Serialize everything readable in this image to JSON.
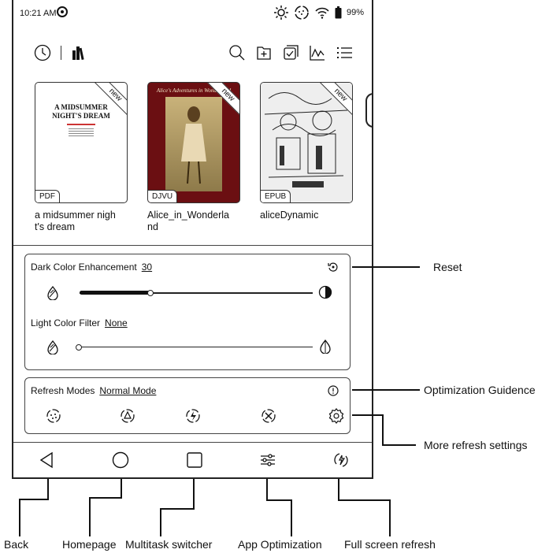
{
  "status_bar": {
    "time": "10:21 AM",
    "battery": "99%"
  },
  "toolbar": {
    "left_icons": [
      "clock-icon",
      "bookshelf-icon"
    ],
    "right_icons": [
      "search-icon",
      "import-icon",
      "select-icon",
      "stats-icon",
      "menu-icon"
    ]
  },
  "books": [
    {
      "title": "a midsummer night's dream",
      "format": "PDF",
      "badge": "new",
      "cover_text": "A MIDSUMMER NIGHT'S DREAM"
    },
    {
      "title": "Alice_in_Wonderland",
      "format": "DJVU",
      "badge": "new",
      "cover_text": "Alice's Adventures in Wonderland"
    },
    {
      "title": "aliceDynamic",
      "format": "EPUB",
      "badge": "new"
    }
  ],
  "panel": {
    "dark_label": "Dark Color Enhancement",
    "dark_value": "30",
    "dark_level": 0.3,
    "light_label": "Light Color Filter",
    "light_value": "None",
    "light_level": 0,
    "refresh_label": "Refresh Modes",
    "refresh_value": "Normal Mode"
  },
  "nav": [
    "back-icon",
    "home-icon",
    "multitask-icon",
    "app-optimization-icon",
    "full-refresh-icon"
  ],
  "callouts": {
    "reset": "Reset",
    "optimization": "Optimization Guidence",
    "more_refresh": "More refresh settings",
    "back": "Back",
    "homepage": "Homepage",
    "multitask": "Multitask switcher",
    "app_opt": "App Optimization",
    "full_refresh": "Full screen refresh"
  }
}
